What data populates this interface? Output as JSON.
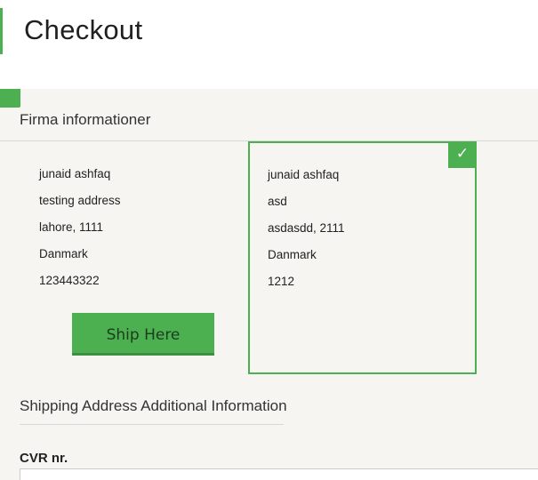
{
  "header": {
    "title": "Checkout",
    "accent_color": "#4caf50"
  },
  "company_section": {
    "title": "Firma informationer"
  },
  "addresses": [
    {
      "name": "junaid ashfaq",
      "street": "testing address",
      "city_zip": "lahore, 1111",
      "country": "Danmark",
      "phone": "123443322",
      "selected": false,
      "action_label": "Ship Here"
    },
    {
      "name": "junaid ashfaq",
      "street": "asd",
      "city_zip": "asdasdd, 2111",
      "country": "Danmark",
      "phone": "1212",
      "selected": true,
      "selected_icon": "check-icon",
      "selected_glyph": "✓"
    }
  ],
  "additional_section": {
    "title": "Shipping Address Additional Information"
  },
  "cvr_field": {
    "label": "CVR nr.",
    "value": "",
    "placeholder": ""
  }
}
